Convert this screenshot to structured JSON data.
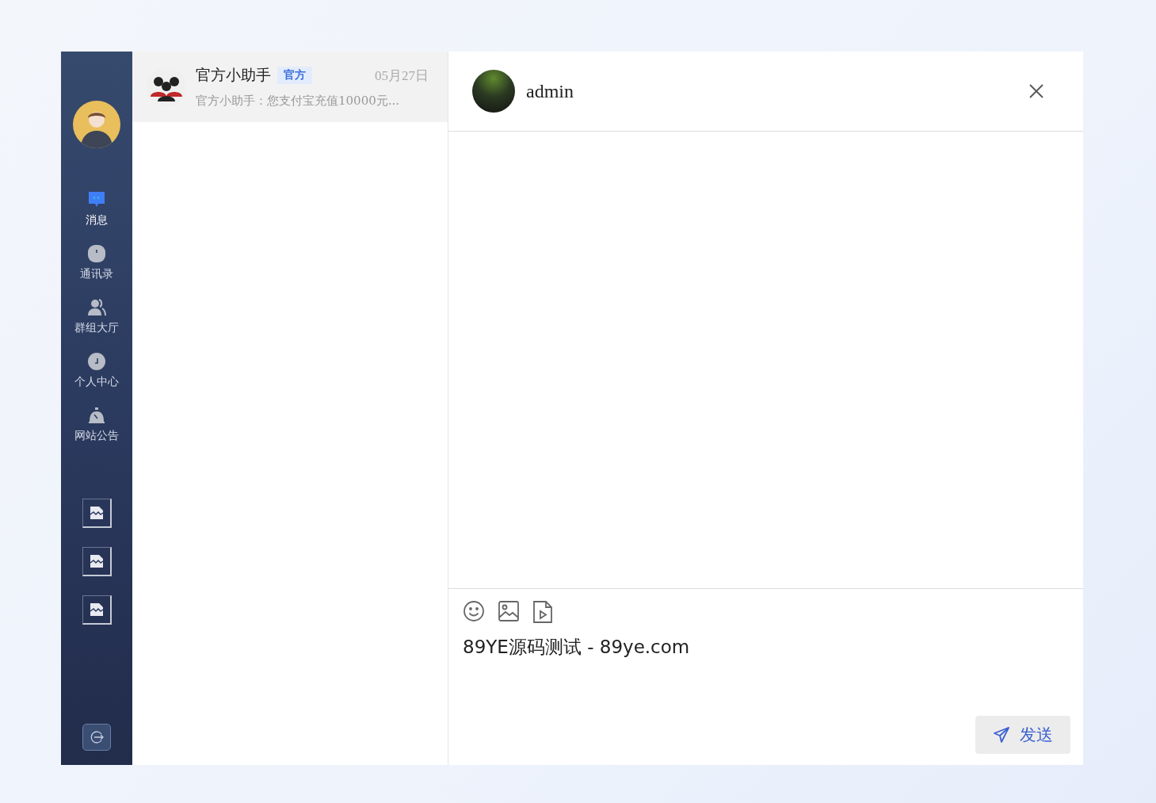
{
  "sidebar": {
    "nav": [
      {
        "label": "消息",
        "kind": "message",
        "selected": true
      },
      {
        "label": "通讯录",
        "kind": "contacts",
        "selected": false
      },
      {
        "label": "群组大厅",
        "kind": "group",
        "selected": false
      },
      {
        "label": "个人中心",
        "kind": "profile",
        "selected": false
      },
      {
        "label": "网站公告",
        "kind": "notice",
        "selected": false
      }
    ],
    "image_links": [
      {
        "kind": "broken_image"
      },
      {
        "kind": "broken_image"
      },
      {
        "kind": "broken_image"
      }
    ]
  },
  "conversations": [
    {
      "name": "官方小助手",
      "badge": "官方",
      "date": "05月27日",
      "preview": "官方小助手：您支付宝充值10000元...",
      "selected": true
    }
  ],
  "chat": {
    "title": "admin",
    "composer": {
      "value": "89YE源码测试 - 89ye.com"
    },
    "send_button": "发送"
  }
}
